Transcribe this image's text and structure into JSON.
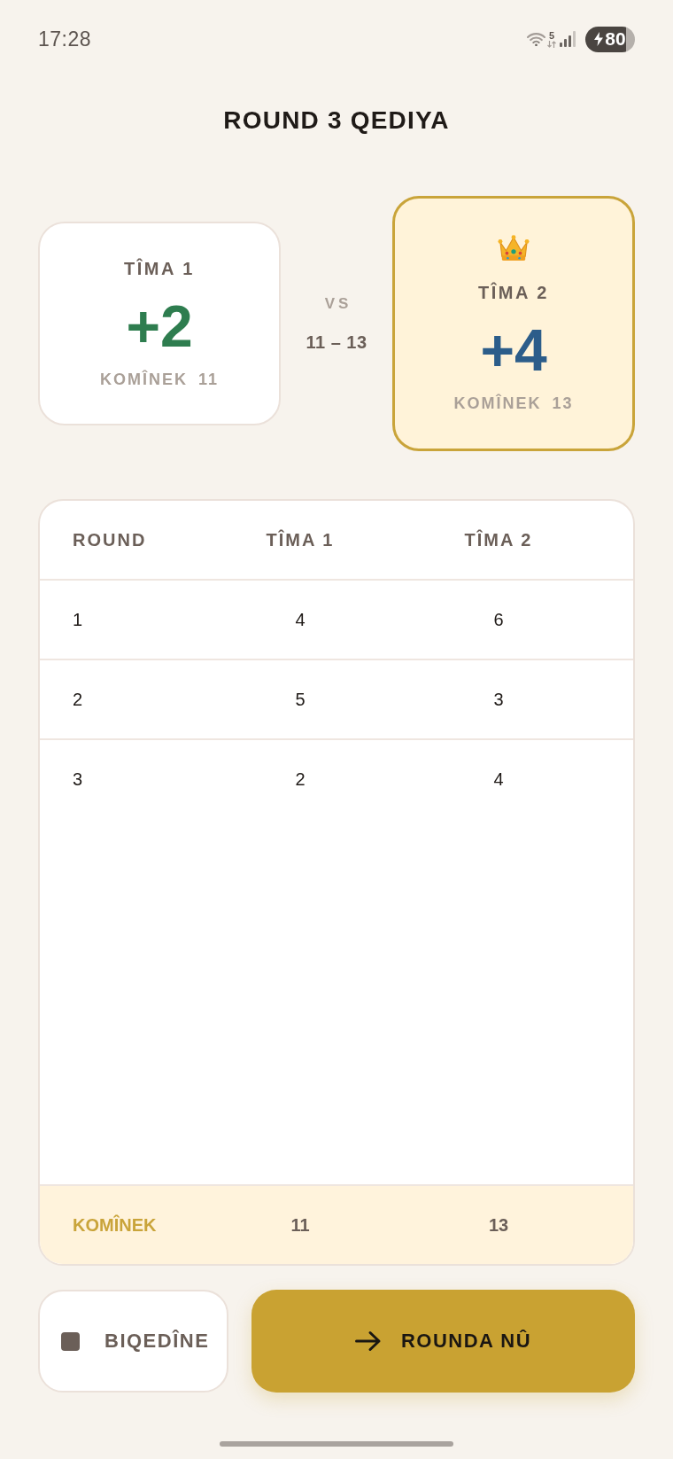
{
  "status_bar": {
    "time": "17:28",
    "wifi_label": "5",
    "battery": "80",
    "charging": true
  },
  "title": "ROUND 3 QEDIYA",
  "teams": [
    {
      "name": "TÎMA 1",
      "delta": "+2",
      "color": "#2e7d4f",
      "total_label": "KOMÎNEK",
      "total": "11",
      "winner": false
    },
    {
      "name": "TÎMA 2",
      "delta": "+4",
      "color": "#2c5d8a",
      "total_label": "KOMÎNEK",
      "total": "13",
      "winner": true
    }
  ],
  "versus": {
    "label": "VS",
    "score": "11 – 13"
  },
  "table": {
    "columns": [
      "ROUND",
      "TÎMA 1",
      "TÎMA 2"
    ],
    "rows": [
      [
        "1",
        "4",
        "6"
      ],
      [
        "2",
        "5",
        "3"
      ],
      [
        "3",
        "2",
        "4"
      ]
    ],
    "totals": {
      "label": "KOMÎNEK",
      "values": [
        "11",
        "13"
      ]
    }
  },
  "buttons": [
    {
      "kind": "stop",
      "label": "BIQEDÎNE"
    },
    {
      "kind": "next",
      "label": "ROUNDA NÛ"
    }
  ]
}
